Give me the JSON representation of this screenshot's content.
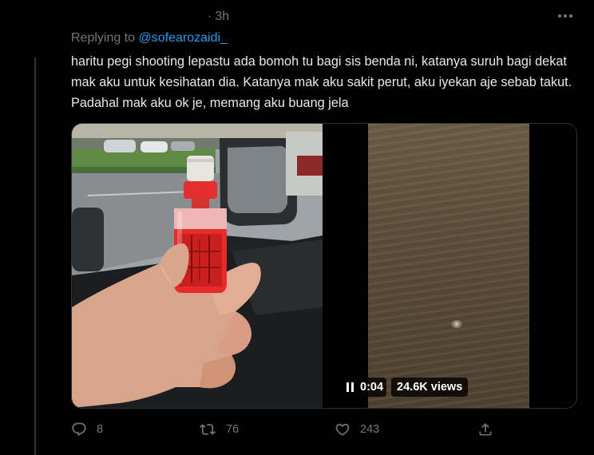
{
  "tweet": {
    "dot": "·",
    "timestamp": "3h",
    "more_icon": "more-dots-icon",
    "replying_prefix": "Replying to",
    "replying_handle": "@sofearozaidi_",
    "text": "haritu pegi shooting lepastu ada bomoh tu bagi sis benda ni, katanya suruh bagi dekat mak aku untuk kesihatan dia. Katanya mak aku sakit perut, aku iyekan aje sebab takut. Padahal mak aku ok je, memang aku buang jela"
  },
  "media": {
    "photo_icon": "hand-holding-red-bottle-photo",
    "video": {
      "state": "playing",
      "time": "0:04",
      "views": "24.6K views"
    }
  },
  "actions": {
    "reply": {
      "icon": "reply-icon",
      "count": "8"
    },
    "retweet": {
      "icon": "retweet-icon",
      "count": "76"
    },
    "like": {
      "icon": "heart-icon",
      "count": "243"
    },
    "share": {
      "icon": "share-icon"
    }
  },
  "colors": {
    "background": "#000000",
    "text": "#e7e9ea",
    "secondary": "#71767b",
    "link": "#1d9bf0",
    "border": "#2f3336"
  }
}
